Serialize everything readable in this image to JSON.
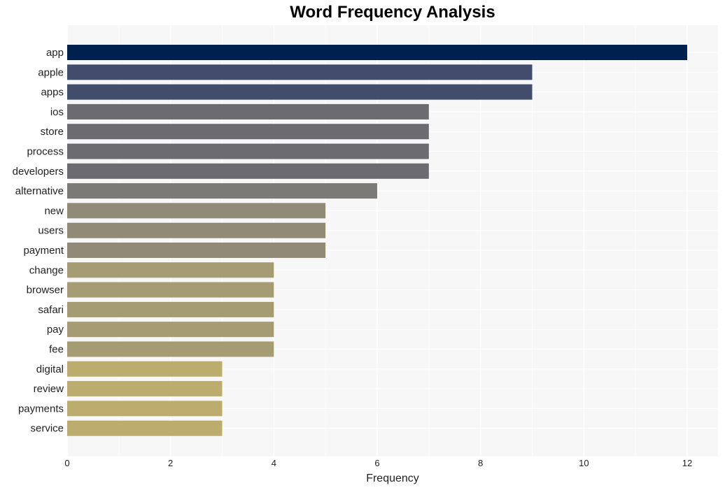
{
  "chart_data": {
    "type": "bar",
    "orientation": "horizontal",
    "title": "Word Frequency Analysis",
    "xlabel": "Frequency",
    "ylabel": "",
    "xlim": [
      0,
      12.6
    ],
    "xticks": [
      0,
      2,
      4,
      6,
      8,
      10,
      12
    ],
    "grid": true,
    "categories": [
      "app",
      "apple",
      "apps",
      "ios",
      "store",
      "process",
      "developers",
      "alternative",
      "new",
      "users",
      "payment",
      "change",
      "browser",
      "safari",
      "pay",
      "fee",
      "digital",
      "review",
      "payments",
      "service"
    ],
    "values": [
      12,
      9,
      9,
      7,
      7,
      7,
      7,
      6,
      5,
      5,
      5,
      4,
      4,
      4,
      4,
      4,
      3,
      3,
      3,
      3
    ],
    "colors": [
      "#00204d",
      "#414d6b",
      "#414d6b",
      "#6b6b70",
      "#6b6b70",
      "#6b6b70",
      "#6b6b70",
      "#7c7a76",
      "#918a76",
      "#918a76",
      "#918a76",
      "#a69c74",
      "#a69c74",
      "#a69c74",
      "#a69c74",
      "#a69c74",
      "#bcad6e",
      "#bcad6e",
      "#bcad6e",
      "#bcad6e"
    ]
  }
}
